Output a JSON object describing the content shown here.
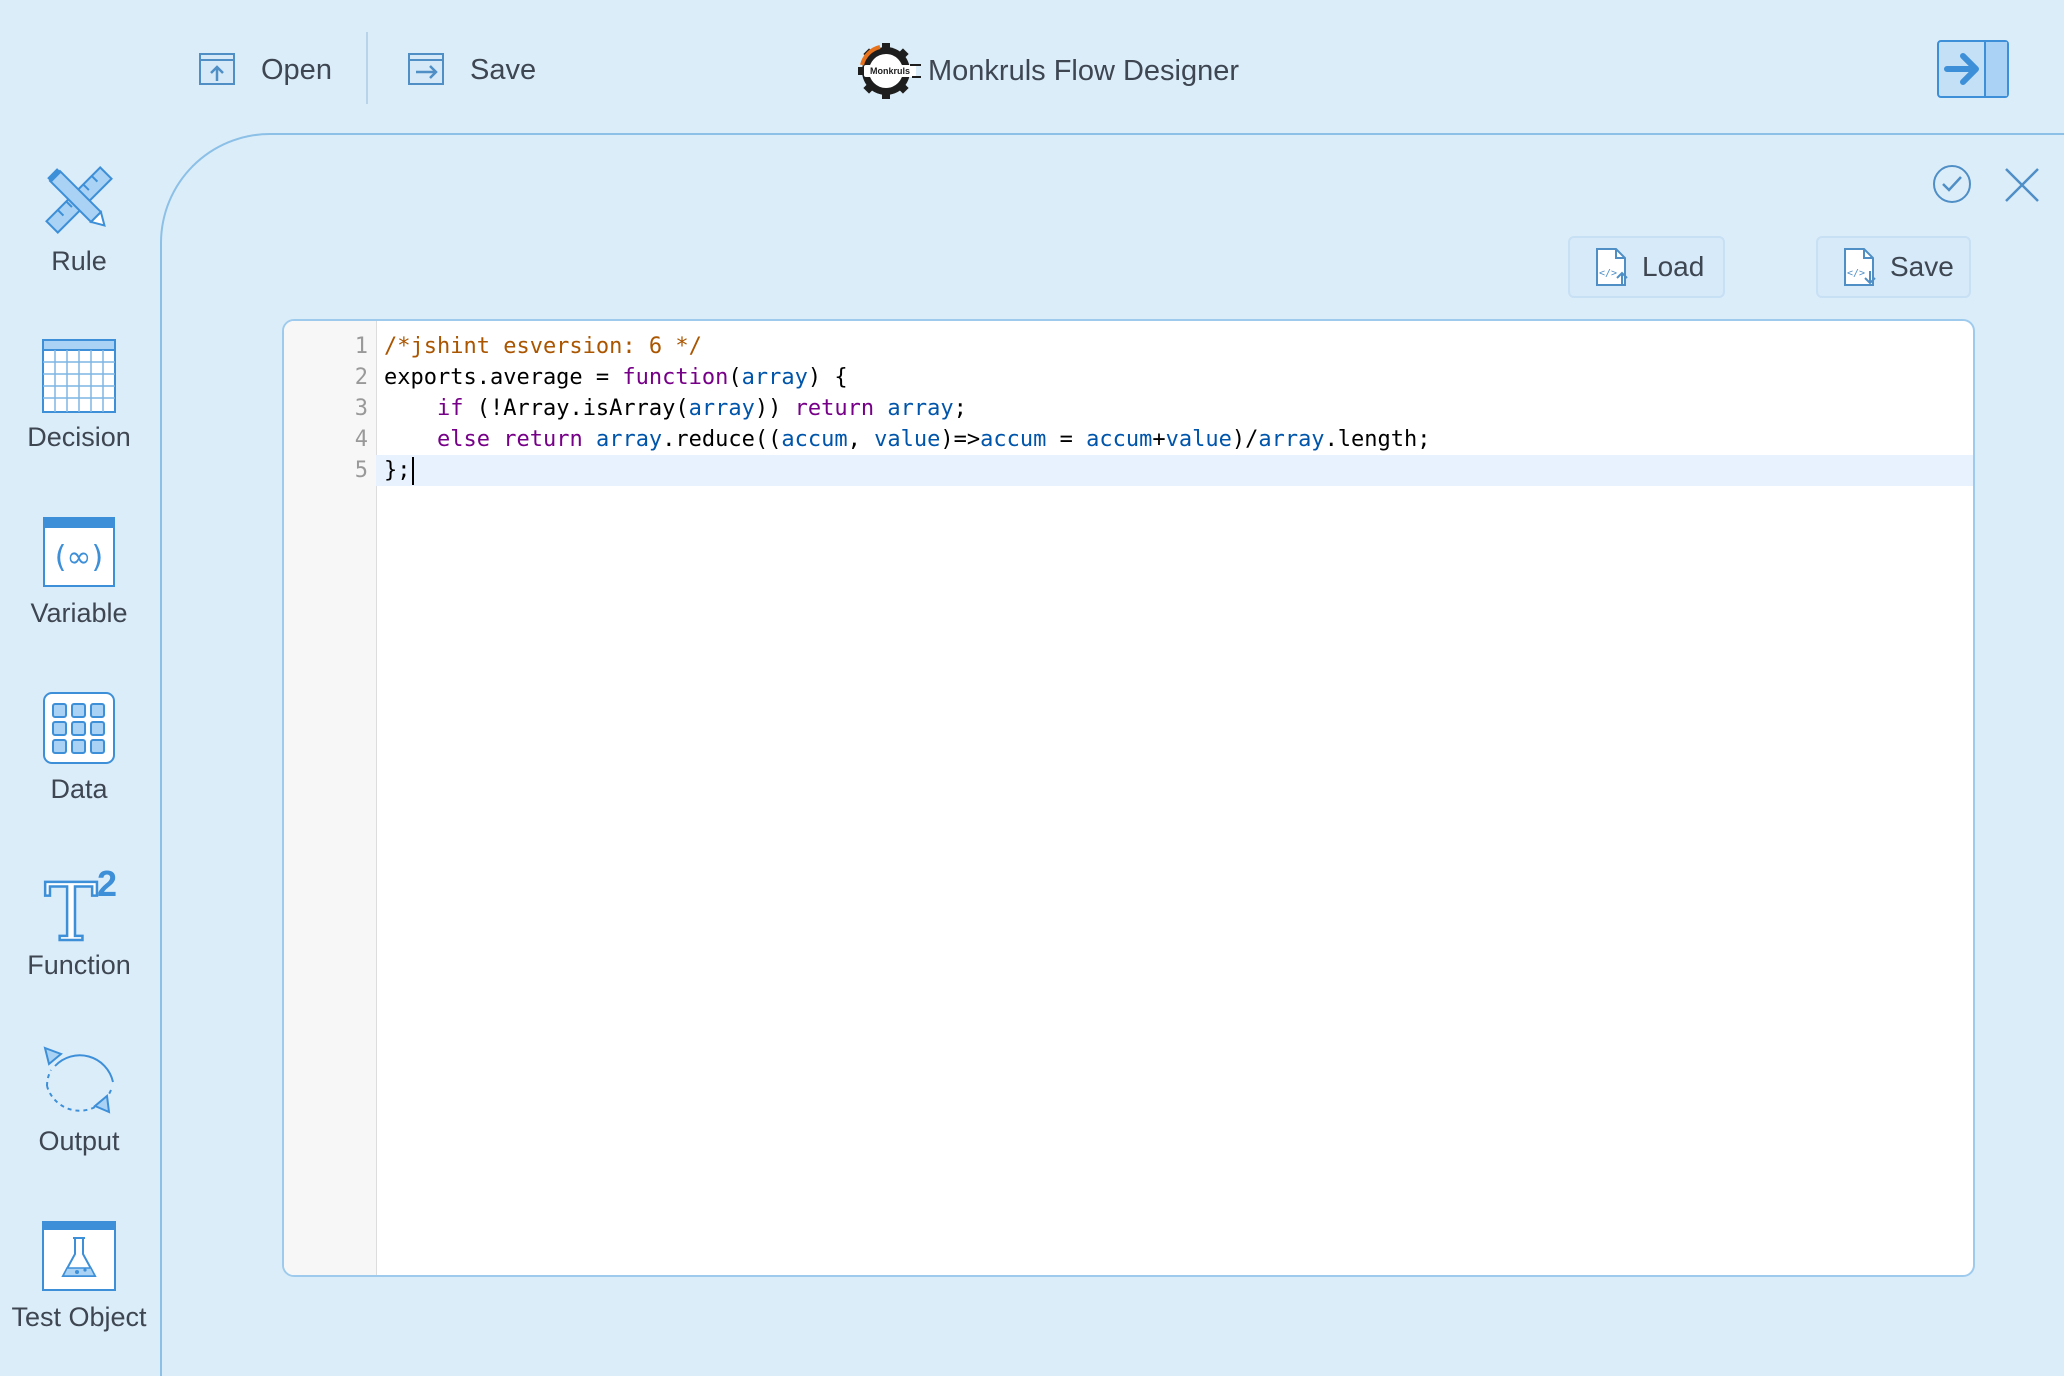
{
  "toolbar": {
    "open_label": "Open",
    "save_label": "Save",
    "app_title": "Monkruls Flow Designer",
    "logo_text": "Monkruls",
    "icons": {
      "open": "open-file-icon",
      "save": "save-file-icon",
      "logo": "gear-logo-icon",
      "collapse": "arrow-right-panel-icon"
    }
  },
  "toolbox": {
    "items": [
      {
        "label": "Rule",
        "icon": "pencil-ruler-icon"
      },
      {
        "label": "Decision",
        "icon": "grid-table-icon"
      },
      {
        "label": "Variable",
        "icon": "variable-icon"
      },
      {
        "label": "Data",
        "icon": "dots-grid-icon"
      },
      {
        "label": "Function",
        "icon": "t-squared-icon"
      },
      {
        "label": "Output",
        "icon": "cycle-arrows-icon"
      },
      {
        "label": "Test Object",
        "icon": "flask-icon"
      }
    ]
  },
  "panel": {
    "confirm_icon": "check-circle-icon",
    "close_icon": "close-x-icon",
    "load_label": "Load",
    "save_label": "Save",
    "load_icon": "code-file-upload-icon",
    "save_icon": "code-file-download-icon"
  },
  "editor": {
    "active_line": 5,
    "lines": [
      "/*jshint esversion: 6 */",
      "exports.average = function(array) {",
      "    if (!Array.isArray(array)) return array;",
      "    else return array.reduce((accum, value)=>accum = accum+value)/array.length;",
      "};"
    ]
  },
  "colors": {
    "background": "#dcedfa",
    "accent": "#3d8fd8",
    "icon_fill": "#a9d2f4",
    "comment": "#aa5500",
    "keyword": "#770088",
    "variable": "#0055aa"
  }
}
